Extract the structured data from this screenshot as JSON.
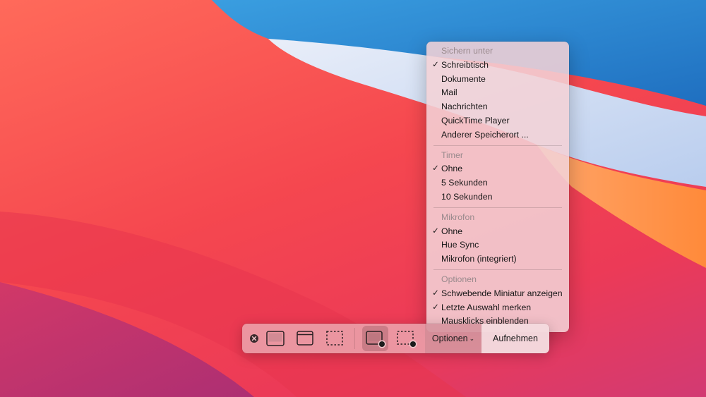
{
  "menu": {
    "save_heading": "Sichern unter",
    "save_items": [
      {
        "label": "Schreibtisch",
        "checked": true
      },
      {
        "label": "Dokumente",
        "checked": false
      },
      {
        "label": "Mail",
        "checked": false
      },
      {
        "label": "Nachrichten",
        "checked": false
      },
      {
        "label": "QuickTime Player",
        "checked": false
      },
      {
        "label": "Anderer Speicherort ...",
        "checked": false
      }
    ],
    "timer_heading": "Timer",
    "timer_items": [
      {
        "label": "Ohne",
        "checked": true
      },
      {
        "label": "5 Sekunden",
        "checked": false
      },
      {
        "label": "10 Sekunden",
        "checked": false
      }
    ],
    "mic_heading": "Mikrofon",
    "mic_items": [
      {
        "label": "Ohne",
        "checked": true
      },
      {
        "label": "Hue Sync",
        "checked": false
      },
      {
        "label": "Mikrofon (integriert)",
        "checked": false
      }
    ],
    "options_heading": "Optionen",
    "options_items": [
      {
        "label": "Schwebende Miniatur anzeigen",
        "checked": true
      },
      {
        "label": "Letzte Auswahl merken",
        "checked": true
      },
      {
        "label": "Mausklicks einblenden",
        "checked": false
      }
    ],
    "check_glyph": "✓"
  },
  "toolbar": {
    "options_label": "Optionen",
    "options_chevron": "⌄",
    "record_label": "Aufnehmen",
    "selected_tool": "record-entire-screen"
  },
  "colors": {
    "wallpaper_red": "#f5474f",
    "wallpaper_blue": "#2f8fd8",
    "wallpaper_orange": "#fb8a3c",
    "record_dot": "#1c1c1c"
  }
}
